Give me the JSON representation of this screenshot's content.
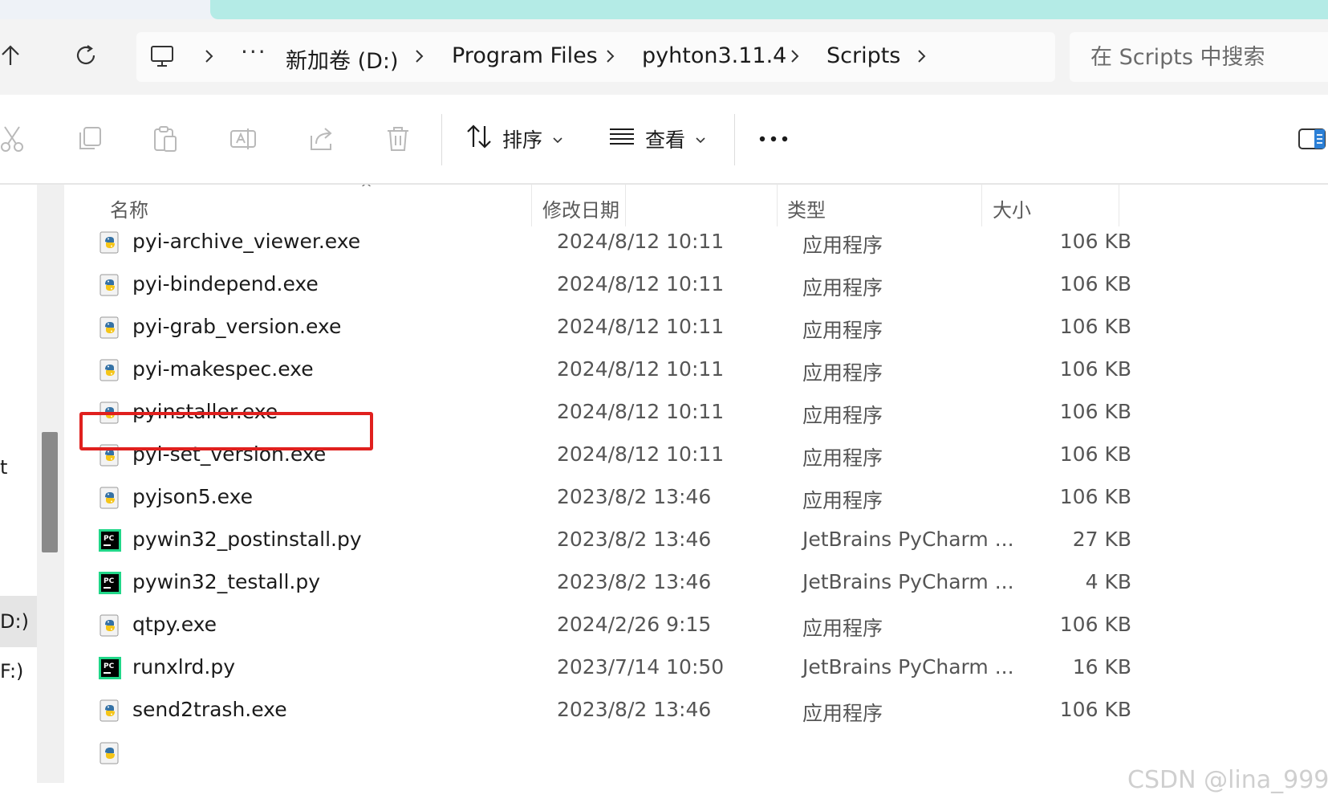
{
  "nav": {
    "breadcrumbs": [
      "新加卷 (D:)",
      "Program Files",
      "pyhton3.11.4",
      "Scripts"
    ],
    "search_placeholder": "在 Scripts 中搜索"
  },
  "toolbar": {
    "sort_label": "排序",
    "view_label": "查看"
  },
  "navpane": {
    "fragments": [
      "t",
      "D:)",
      "F:)"
    ]
  },
  "columns": {
    "name": "名称",
    "modified": "修改日期",
    "type": "类型",
    "size": "大小"
  },
  "files": [
    {
      "name": "pyi-archive_viewer.exe",
      "modified": "2024/8/12 10:11",
      "type": "应用程序",
      "size": "106 KB",
      "icon": "python-exe-icon"
    },
    {
      "name": "pyi-bindepend.exe",
      "modified": "2024/8/12 10:11",
      "type": "应用程序",
      "size": "106 KB",
      "icon": "python-exe-icon"
    },
    {
      "name": "pyi-grab_version.exe",
      "modified": "2024/8/12 10:11",
      "type": "应用程序",
      "size": "106 KB",
      "icon": "python-exe-icon"
    },
    {
      "name": "pyi-makespec.exe",
      "modified": "2024/8/12 10:11",
      "type": "应用程序",
      "size": "106 KB",
      "icon": "python-exe-icon"
    },
    {
      "name": "pyinstaller.exe",
      "modified": "2024/8/12 10:11",
      "type": "应用程序",
      "size": "106 KB",
      "icon": "python-exe-icon",
      "highlighted": true
    },
    {
      "name": "pyi-set_version.exe",
      "modified": "2024/8/12 10:11",
      "type": "应用程序",
      "size": "106 KB",
      "icon": "python-exe-icon"
    },
    {
      "name": "pyjson5.exe",
      "modified": "2023/8/2 13:46",
      "type": "应用程序",
      "size": "106 KB",
      "icon": "python-exe-icon"
    },
    {
      "name": "pywin32_postinstall.py",
      "modified": "2023/8/2 13:46",
      "type": "JetBrains PyCharm ...",
      "size": "27 KB",
      "icon": "pycharm-file-icon"
    },
    {
      "name": "pywin32_testall.py",
      "modified": "2023/8/2 13:46",
      "type": "JetBrains PyCharm ...",
      "size": "4 KB",
      "icon": "pycharm-file-icon"
    },
    {
      "name": "qtpy.exe",
      "modified": "2024/2/26 9:15",
      "type": "应用程序",
      "size": "106 KB",
      "icon": "python-exe-icon"
    },
    {
      "name": "runxlrd.py",
      "modified": "2023/7/14 10:50",
      "type": "JetBrains PyCharm ...",
      "size": "16 KB",
      "icon": "pycharm-file-icon"
    },
    {
      "name": "send2trash.exe",
      "modified": "2023/8/2 13:46",
      "type": "应用程序",
      "size": "106 KB",
      "icon": "python-exe-icon"
    }
  ],
  "watermark": "CSDN @lina_999",
  "colors": {
    "tab_accent": "#b4ebe6",
    "highlight_box": "#e0201e",
    "pycharm_green": "#21d789"
  }
}
